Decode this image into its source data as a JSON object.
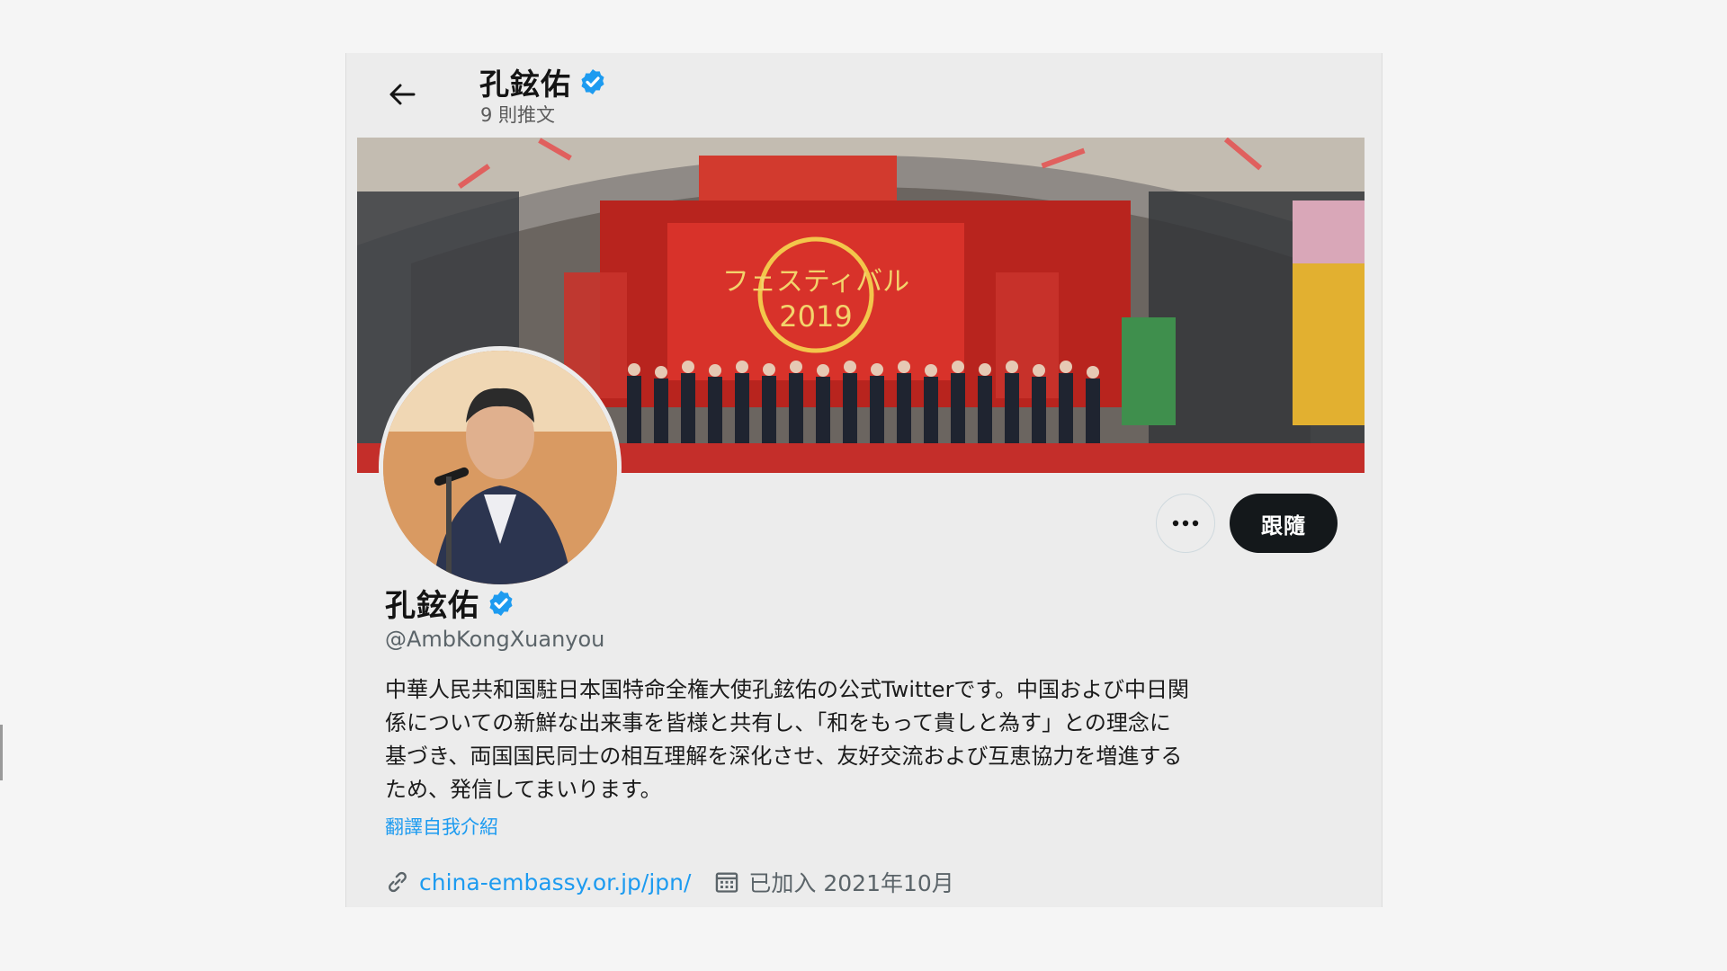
{
  "header": {
    "name": "孔鉉佑",
    "tweet_count": "9 則推文"
  },
  "banner": {
    "stage_text": "フェスティバル 2019"
  },
  "actions": {
    "follow_label": "跟隨",
    "more_icon": "more-dots-icon"
  },
  "profile": {
    "name": "孔鉉佑",
    "handle": "@AmbKongXuanyou",
    "bio_lines": [
      "中華人民共和国駐日本国特命全権大使孔鉉佑の公式Twitterです。中国および中日関",
      "係についての新鮮な出来事を皆様と共有し、「和をもって貴しと為す」との理念に",
      "基づき、両国国民同士の相互理解を深化させ、友好交流および互恵協力を増進する",
      "ため、発信してまいります。"
    ],
    "translate_label": "翻譯自我介紹",
    "website": "china-embassy.or.jp/jpn/",
    "joined": "已加入 2021年10月"
  },
  "colors": {
    "accent": "#1d9bf0",
    "follow_bg": "#14181b",
    "background": "#ececec"
  }
}
